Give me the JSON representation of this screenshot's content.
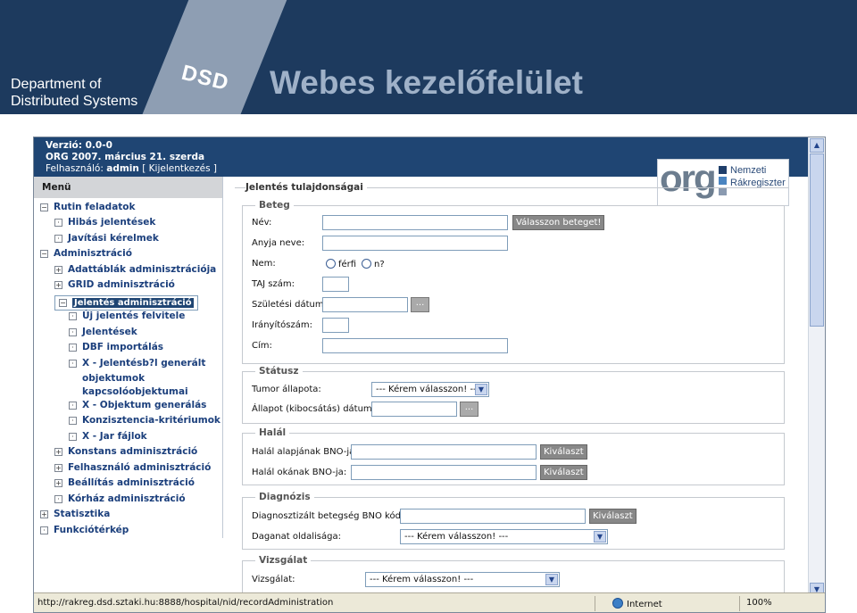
{
  "banner": {
    "dept_line1": "Department of",
    "dept_line2": "Distributed Systems",
    "dsd": "DSD",
    "title": "Webes kezelőfelület",
    "bg_color": "#1d3a5e"
  },
  "header": {
    "version": "Verzió: 0.0-0",
    "date": "ORG 2007. március 21. szerda",
    "user_label": "Felhasználó:",
    "user": "admin",
    "logout": "[ Kijelentkezés ]"
  },
  "logo": {
    "org": "org",
    "line1": "Nemzeti",
    "line2": "Rákregiszter"
  },
  "menu": {
    "title": "Menü",
    "items": [
      {
        "label": "Rutin feladatok",
        "box": "−"
      },
      {
        "label": "Hibás jelentések",
        "box": "·"
      },
      {
        "label": "Javítási kérelmek",
        "box": "·"
      },
      {
        "label": "Adminisztráció",
        "box": "−"
      },
      {
        "label": "Adattáblák adminisztrációja",
        "box": "+"
      },
      {
        "label": "GRID adminisztráció",
        "box": "+"
      },
      {
        "label": "Jelentés adminisztráció",
        "box": "−"
      },
      {
        "label": "Új jelentés felvitele",
        "box": "·"
      },
      {
        "label": "Jelentések",
        "box": "·"
      },
      {
        "label": "DBF importálás",
        "box": "·"
      },
      {
        "label": "X - Jelentésb?l generált",
        "box": "·"
      },
      {
        "label": "objektumok",
        "box": ""
      },
      {
        "label": "kapcsolóobjektumai",
        "box": ""
      },
      {
        "label": "X - Objektum generálás",
        "box": "·"
      },
      {
        "label": "Konzisztencia-kritériumok",
        "box": "·"
      },
      {
        "label": "X - Jar fájlok",
        "box": "·"
      },
      {
        "label": "Konstans adminisztráció",
        "box": "+"
      },
      {
        "label": "Felhasználó adminisztráció",
        "box": "+"
      },
      {
        "label": "Beállítás adminisztráció",
        "box": "+"
      },
      {
        "label": "Kórház adminisztráció",
        "box": "·"
      },
      {
        "label": "Statisztika",
        "box": "+"
      },
      {
        "label": "Funkciótérkép",
        "box": "·"
      }
    ]
  },
  "form": {
    "title": "Jelentés tulajdonságai",
    "beteg": {
      "legend": "Beteg",
      "name_label": "Név:",
      "select_patient": "Válasszon beteget!",
      "mother_label": "Anyja neve:",
      "sex_label": "Nem:",
      "male": "férfi",
      "female": "n?",
      "taj_label": "TAJ szám:",
      "birth_label": "Születési dátum:",
      "dots": "...",
      "zip_label": "Irányítószám:",
      "address_label": "Cím:"
    },
    "statusz": {
      "legend": "Státusz",
      "tumor_label": "Tumor állapota:",
      "tumor_value": "--- Kérem válasszon! ---",
      "state_label": "Állapot (kibocsátás) dátuma:",
      "dots": "..."
    },
    "halal": {
      "legend": "Halál",
      "base_label": "Halál alapjának BNO-ja:",
      "cause_label": "Halál okának BNO-ja:",
      "choose": "Kiválaszt"
    },
    "diagnozis": {
      "legend": "Diagnózis",
      "bno_label": "Diagnosztizált betegség BNO kódja:",
      "choose": "Kiválaszt",
      "side_label": "Daganat oldalisága:",
      "side_value": "--- Kérem válasszon! ---"
    },
    "vizsgalat": {
      "legend": "Vizsgálat",
      "exam_label": "Vizsgálat:",
      "exam_value": "--- Kérem válasszon! ---"
    }
  },
  "statusbar": {
    "url": "http://rakreg.dsd.sztaki.hu:8888/hospital/nid/recordAdministration",
    "zone": "Internet",
    "zoom": "100%"
  }
}
